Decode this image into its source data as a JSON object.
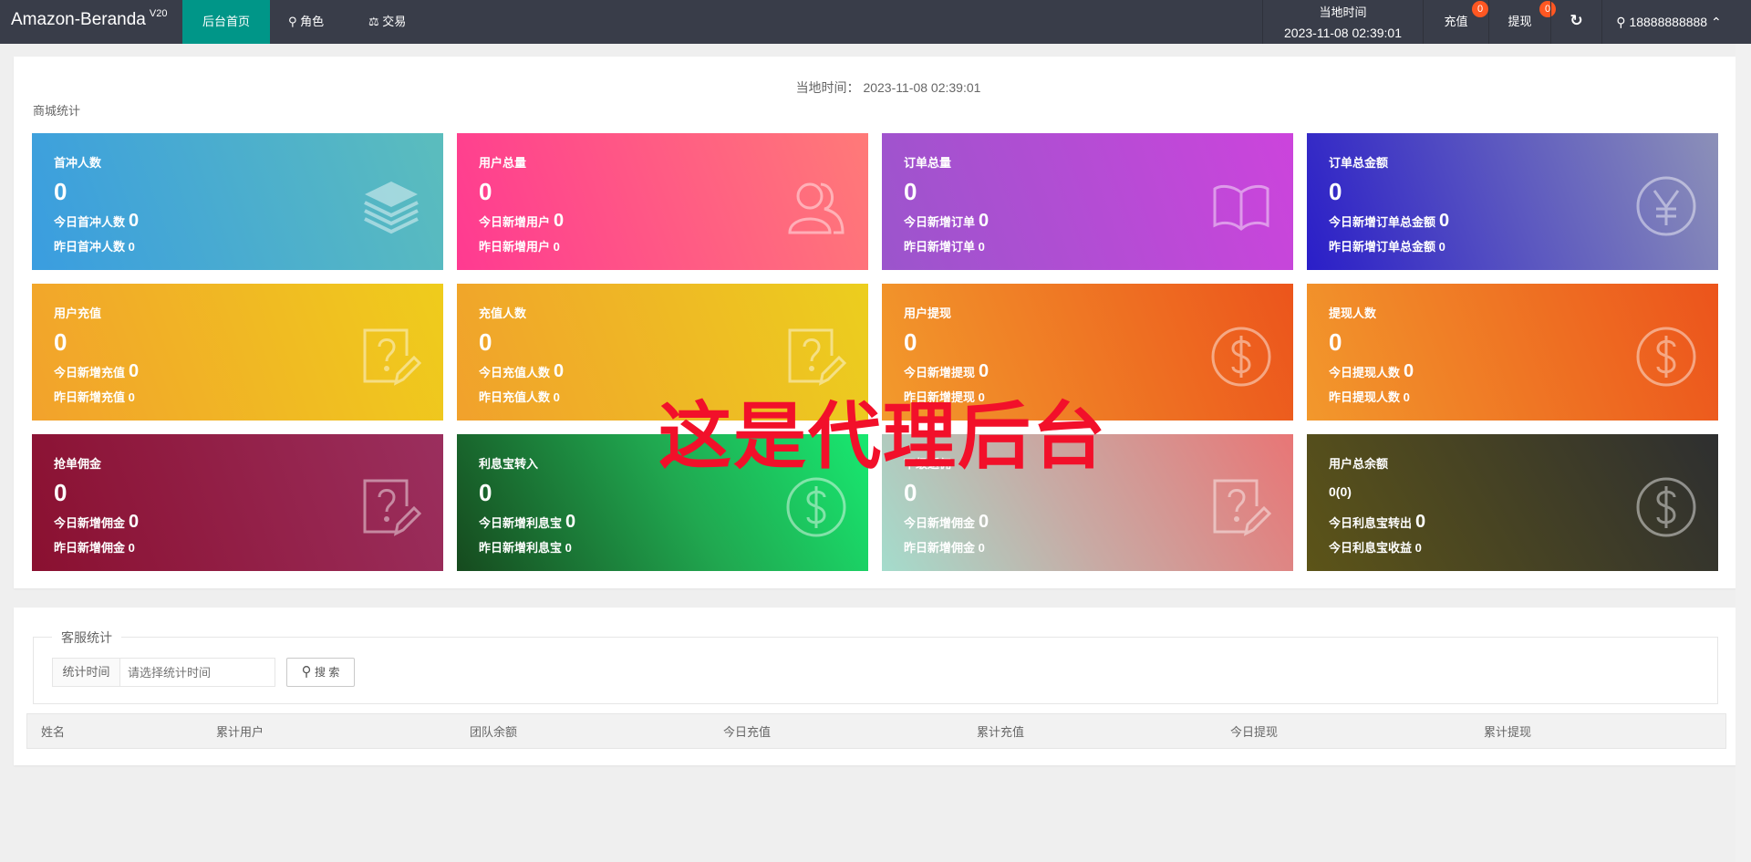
{
  "header": {
    "logo": "Amazon-Beranda",
    "version": "V20",
    "nav": [
      {
        "label": "后台首页",
        "icon": "home",
        "active": true
      },
      {
        "label": "角色",
        "icon": "user-icon"
      },
      {
        "label": "交易",
        "icon": "scale-icon"
      }
    ],
    "time_label": "当地时间",
    "time_value": "2023-11-08 02:39:01",
    "recharge": {
      "label": "充值",
      "badge": "0"
    },
    "withdraw": {
      "label": "提现",
      "badge": "0"
    },
    "user": "18888888888"
  },
  "mall": {
    "local_time_label": "当地时间：",
    "local_time": "2023-11-08 02:39:01",
    "title": "商城统计"
  },
  "cards": [
    {
      "title": "首冲人数",
      "value": "0",
      "today_label": "今日首冲人数",
      "today": "0",
      "yesterday_label": "昨日首冲人数",
      "yesterday": "0",
      "icon": "layers"
    },
    {
      "title": "用户总量",
      "value": "0",
      "today_label": "今日新增用户",
      "today": "0",
      "yesterday_label": "昨日新增用户",
      "yesterday": "0",
      "icon": "users"
    },
    {
      "title": "订单总量",
      "value": "0",
      "today_label": "今日新增订单",
      "today": "0",
      "yesterday_label": "昨日新增订单",
      "yesterday": "0",
      "icon": "book"
    },
    {
      "title": "订单总金额",
      "value": "0",
      "today_label": "今日新增订单总金额",
      "today": "0",
      "yesterday_label": "昨日新增订单总金额",
      "yesterday": "0",
      "icon": "yen"
    },
    {
      "title": "用户充值",
      "value": "0",
      "today_label": "今日新增充值",
      "today": "0",
      "yesterday_label": "昨日新增充值",
      "yesterday": "0",
      "icon": "note"
    },
    {
      "title": "充值人数",
      "value": "0",
      "today_label": "今日充值人数",
      "today": "0",
      "yesterday_label": "昨日充值人数",
      "yesterday": "0",
      "icon": "note"
    },
    {
      "title": "用户提现",
      "value": "0",
      "today_label": "今日新增提现",
      "today": "0",
      "yesterday_label": "昨日新增提现",
      "yesterday": "0",
      "icon": "dollar"
    },
    {
      "title": "提现人数",
      "value": "0",
      "today_label": "今日提现人数",
      "today": "0",
      "yesterday_label": "昨日提现人数",
      "yesterday": "0",
      "icon": "dollar"
    },
    {
      "title": "抢单佣金",
      "value": "0",
      "today_label": "今日新增佣金",
      "today": "0",
      "yesterday_label": "昨日新增佣金",
      "yesterday": "0",
      "icon": "note"
    },
    {
      "title": "利息宝转入",
      "value": "0",
      "today_label": "今日新增利息宝",
      "today": "0",
      "yesterday_label": "昨日新增利息宝",
      "yesterday": "0",
      "icon": "dollar"
    },
    {
      "title": "下级返佣",
      "value": "0",
      "today_label": "今日新增佣金",
      "today": "0",
      "yesterday_label": "昨日新增佣金",
      "yesterday": "0",
      "icon": "note"
    },
    {
      "title": "用户总余额",
      "value": "0(0)",
      "today_label": "今日利息宝转出",
      "today": "0",
      "yesterday_label": "今日利息宝收益",
      "yesterday": "0",
      "icon": "dollar"
    }
  ],
  "watermark": "这是代理后台",
  "service": {
    "legend": "客服统计",
    "time_label": "统计时间",
    "time_placeholder": "请选择统计时间",
    "search_label": "搜 索",
    "columns": [
      "姓名",
      "累计用户",
      "团队余额",
      "今日充值",
      "累计充值",
      "今日提现",
      "累计提现"
    ]
  }
}
